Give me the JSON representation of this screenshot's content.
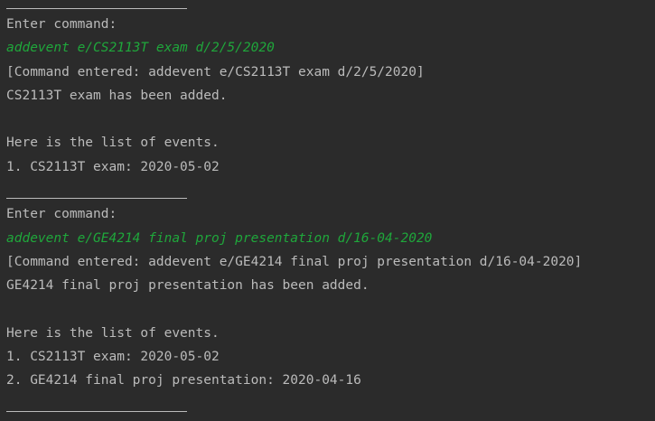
{
  "console": {
    "blocks": [
      {
        "prompt": "Enter command:",
        "input": "addevent e/CS2113T exam d/2/5/2020",
        "echo": "[Command entered: addevent e/CS2113T exam d/2/5/2020]",
        "result": "CS2113T exam has been added.",
        "list_header": "Here is the list of events.",
        "events": [
          "1. CS2113T exam: 2020-05-02"
        ]
      },
      {
        "prompt": "Enter command:",
        "input": "addevent e/GE4214 final proj presentation d/16-04-2020",
        "echo": "[Command entered: addevent e/GE4214 final proj presentation d/16-04-2020]",
        "result": "GE4214 final proj presentation has been added.",
        "list_header": "Here is the list of events.",
        "events": [
          "1. CS2113T exam: 2020-05-02",
          "2. GE4214 final proj presentation: 2020-04-16"
        ]
      }
    ],
    "colors": {
      "background": "#2b2b2b",
      "text": "#bbbbbb",
      "user_input": "#1fa73b"
    }
  }
}
